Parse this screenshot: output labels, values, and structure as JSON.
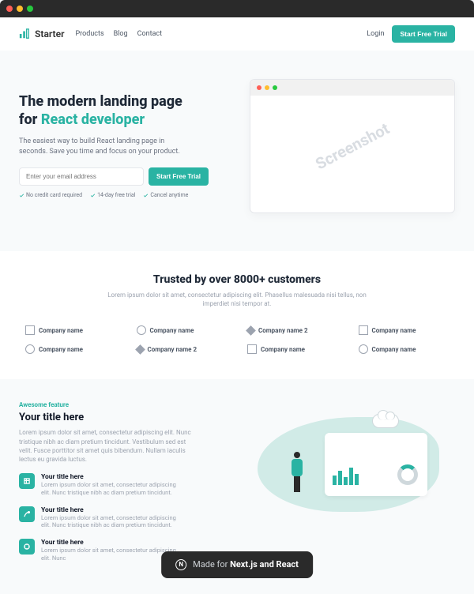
{
  "header": {
    "brand": "Starter",
    "nav": [
      "Products",
      "Blog",
      "Contact"
    ],
    "login": "Login",
    "cta": "Start Free Trial"
  },
  "hero": {
    "title_line1": "The modern landing page",
    "title_line2_prefix": "for ",
    "title_line2_accent": "React developer",
    "subtitle": "The easiest way to build React landing page in seconds. Save you time and focus on your product.",
    "email_placeholder": "Enter your email address",
    "cta": "Start Free Trial",
    "checks": [
      "No credit card required",
      "14-day free trial",
      "Cancel anytime"
    ],
    "screenshot_label": "Screenshot"
  },
  "trusted": {
    "title": "Trusted by over 8000+ customers",
    "subtitle": "Lorem ipsum dolor sit amet, consectetur adipiscing elit. Phasellus malesuada nisi tellus, non imperdiet nisi tempor at.",
    "brands": [
      {
        "name": "Company name",
        "icon": "square"
      },
      {
        "name": "Company name",
        "icon": "circle"
      },
      {
        "name": "Company name 2",
        "icon": "diamond"
      },
      {
        "name": "Company name",
        "icon": "square"
      },
      {
        "name": "Company name",
        "icon": "circle"
      },
      {
        "name": "Company name 2",
        "icon": "diamond"
      },
      {
        "name": "Company name",
        "icon": "square"
      },
      {
        "name": "Company name",
        "icon": "circle"
      }
    ]
  },
  "feature": {
    "overtitle": "Awesome feature",
    "title": "Your title here",
    "desc": "Lorem ipsum dolor sit amet, consectetur adipiscing elit. Nunc tristique nibh ac diam pretium tincidunt. Vestibulum sed est velit. Fusce porttitor sit amet quis bibendum. Nullam iaculis lectus eu gravida luctus.",
    "items": [
      {
        "title": "Your title here",
        "desc": "Lorem ipsum dolor sit amet, consectetur adipiscing elit. Nunc tristique nibh ac diam pretium tincidunt."
      },
      {
        "title": "Your title here",
        "desc": "Lorem ipsum dolor sit amet, consectetur adipiscing elit. Nunc tristique nibh ac diam pretium tincidunt."
      },
      {
        "title": "Your title here",
        "desc": "Lorem ipsum dolor sit amet, consectetur adipiscing elit. Nunc"
      }
    ]
  },
  "banner": {
    "prefix": "Made for",
    "bold": "Next.js and React"
  }
}
